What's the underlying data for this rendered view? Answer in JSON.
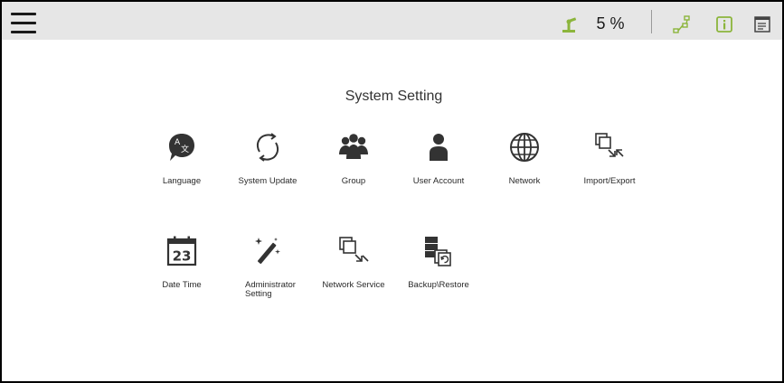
{
  "header": {
    "speed": "5 %",
    "colors": {
      "accent": "#8cb53c",
      "bar": "#e6e6e6"
    }
  },
  "main": {
    "title": "System Setting",
    "tiles": [
      {
        "label": "Language",
        "icon": "language-icon"
      },
      {
        "label": "System Update",
        "icon": "system-update-icon"
      },
      {
        "label": "Group",
        "icon": "group-icon"
      },
      {
        "label": "User Account",
        "icon": "user-account-icon"
      },
      {
        "label": "Network",
        "icon": "globe-icon"
      },
      {
        "label": "Import/Export",
        "icon": "import-export-icon"
      },
      {
        "label": "Date Time",
        "icon": "calendar-icon",
        "badge": "23"
      },
      {
        "label": "Administrator Setting",
        "label_line1": "Administrator",
        "label_line2": "Setting",
        "icon": "magic-wand-icon"
      },
      {
        "label": "Network Service",
        "icon": "network-service-icon"
      },
      {
        "label": "Backup\\Restore",
        "icon": "backup-restore-icon"
      }
    ]
  }
}
